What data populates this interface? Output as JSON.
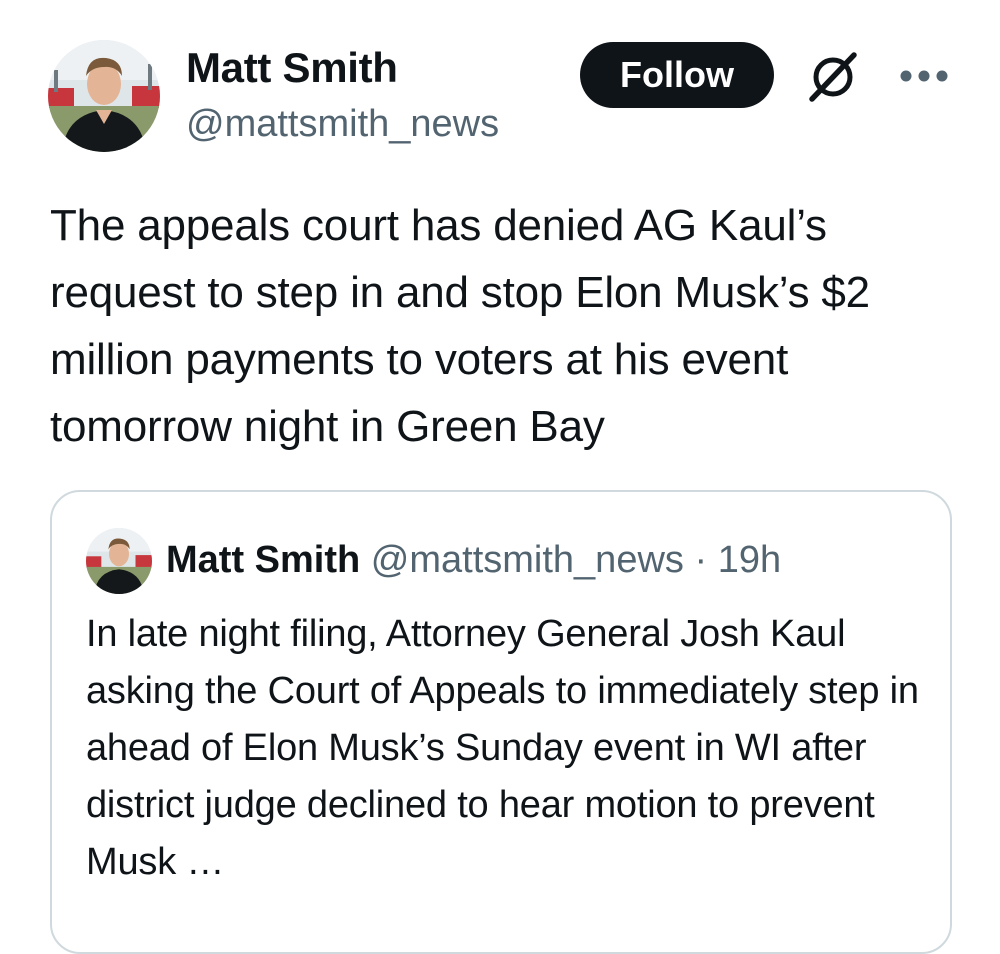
{
  "tweet": {
    "author": {
      "display_name": "Matt Smith",
      "handle": "@mattsmith_news"
    },
    "follow_label": "Follow",
    "icons": {
      "grok": "grok-icon",
      "more": "more-icon"
    },
    "text": "The appeals court has denied AG Kaul’s request to step in and stop Elon Musk’s $2 million payments to voters at his event tomorrow night in Green Bay"
  },
  "quote": {
    "display_name": "Matt Smith",
    "handle": "@mattsmith_news",
    "separator": "·",
    "time": "19h",
    "text": "In late night filing, Attorney General Josh Kaul asking the Court of Appeals to immediately step in ahead of Elon Musk’s Sunday event in WI after district judge declined to hear motion to prevent Musk …"
  },
  "colors": {
    "text_primary": "#0f1419",
    "text_secondary": "#536471",
    "button_bg": "#0f1419",
    "border": "#cfd9de"
  }
}
